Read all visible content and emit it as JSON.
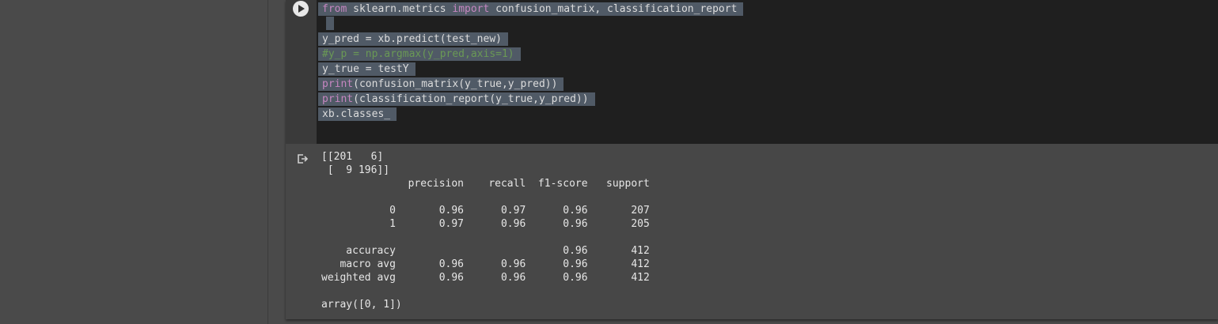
{
  "code": {
    "lines": [
      {
        "parts": [
          {
            "t": "from",
            "c": "kw"
          },
          {
            "t": " sklearn.metrics ",
            "c": ""
          },
          {
            "t": "import",
            "c": "kw"
          },
          {
            "t": " confusion_matrix, classification_report",
            "c": ""
          }
        ]
      },
      {
        "parts": []
      },
      {
        "parts": [
          {
            "t": "y_pred = xb.predict(test_new)",
            "c": ""
          }
        ]
      },
      {
        "parts": [
          {
            "t": "#y_p = np.argmax(y_pred,axis=1)",
            "c": "cm"
          }
        ]
      },
      {
        "parts": [
          {
            "t": "y_true = testY",
            "c": ""
          }
        ]
      },
      {
        "parts": [
          {
            "t": "print",
            "c": "kw"
          },
          {
            "t": "(confusion_matrix(y_true,y_pred))",
            "c": ""
          }
        ]
      },
      {
        "parts": [
          {
            "t": "print",
            "c": "kw"
          },
          {
            "t": "(classification_report(y_true,y_pred))",
            "c": ""
          }
        ]
      },
      {
        "parts": [
          {
            "t": "xb.classes_",
            "c": ""
          }
        ]
      }
    ]
  },
  "output": {
    "text": "[[201   6]\n [  9 196]]\n              precision    recall  f1-score   support\n\n           0       0.96      0.97      0.96       207\n           1       0.97      0.96      0.96       205\n\n    accuracy                           0.96       412\n   macro avg       0.96      0.96      0.96       412\nweighted avg       0.96      0.96      0.96       412\n\narray([0, 1])"
  }
}
